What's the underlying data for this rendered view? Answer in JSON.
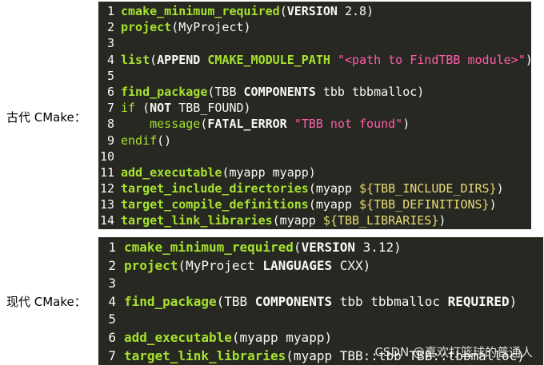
{
  "labels": {
    "old": "古代 CMake：",
    "modern": "现代 CMake："
  },
  "old_block": {
    "lines": [
      {
        "n": "1",
        "parts": [
          {
            "c": "t-k",
            "t": "cmake_minimum_required"
          },
          {
            "c": "t-p",
            "t": "("
          },
          {
            "c": "t-a",
            "t": "VERSION"
          },
          {
            "c": "t-n",
            "t": " 2.8)"
          }
        ]
      },
      {
        "n": "2",
        "parts": [
          {
            "c": "t-k",
            "t": "project"
          },
          {
            "c": "t-n",
            "t": "(MyProject)"
          }
        ]
      },
      {
        "n": "3",
        "parts": []
      },
      {
        "n": "4",
        "parts": [
          {
            "c": "t-k",
            "t": "list"
          },
          {
            "c": "t-p",
            "t": "("
          },
          {
            "c": "t-a",
            "t": "APPEND"
          },
          {
            "c": "t-n",
            "t": " "
          },
          {
            "c": "t-k",
            "t": "CMAKE_MODULE_PATH"
          },
          {
            "c": "t-n",
            "t": " "
          },
          {
            "c": "t-q",
            "t": "\"<path to FindTBB module>\""
          },
          {
            "c": "t-n",
            "t": ")"
          }
        ]
      },
      {
        "n": "5",
        "parts": []
      },
      {
        "n": "6",
        "parts": [
          {
            "c": "t-k",
            "t": "find_package"
          },
          {
            "c": "t-n",
            "t": "(TBB "
          },
          {
            "c": "t-a",
            "t": "COMPONENTS"
          },
          {
            "c": "t-n",
            "t": " tbb tbbmalloc)"
          }
        ]
      },
      {
        "n": "7",
        "parts": [
          {
            "c": "t-f",
            "t": "if"
          },
          {
            "c": "t-n",
            "t": " ("
          },
          {
            "c": "t-a",
            "t": "NOT"
          },
          {
            "c": "t-n",
            "t": " TBB_FOUND)"
          }
        ]
      },
      {
        "n": "8",
        "parts": [
          {
            "c": "t-n",
            "t": "    "
          },
          {
            "c": "t-f",
            "t": "message"
          },
          {
            "c": "t-n",
            "t": "("
          },
          {
            "c": "t-a",
            "t": "FATAL_ERROR"
          },
          {
            "c": "t-n",
            "t": " "
          },
          {
            "c": "t-q",
            "t": "\"TBB not found\""
          },
          {
            "c": "t-n",
            "t": ")"
          }
        ]
      },
      {
        "n": "9",
        "parts": [
          {
            "c": "t-f",
            "t": "endif"
          },
          {
            "c": "t-n",
            "t": "()"
          }
        ]
      },
      {
        "n": "10",
        "parts": []
      },
      {
        "n": "11",
        "parts": [
          {
            "c": "t-k",
            "t": "add_executable"
          },
          {
            "c": "t-n",
            "t": "(myapp myapp)"
          }
        ]
      },
      {
        "n": "12",
        "parts": [
          {
            "c": "t-k",
            "t": "target_include_directories"
          },
          {
            "c": "t-n",
            "t": "(myapp "
          },
          {
            "c": "t-s",
            "t": "${TBB_INCLUDE_DIRS}"
          },
          {
            "c": "t-n",
            "t": ")"
          }
        ]
      },
      {
        "n": "13",
        "parts": [
          {
            "c": "t-k",
            "t": "target_compile_definitions"
          },
          {
            "c": "t-n",
            "t": "(myapp "
          },
          {
            "c": "t-s",
            "t": "${TBB_DEFINITIONS}"
          },
          {
            "c": "t-n",
            "t": ")"
          }
        ]
      },
      {
        "n": "14",
        "parts": [
          {
            "c": "t-k",
            "t": "target_link_libraries"
          },
          {
            "c": "t-n",
            "t": "(myapp "
          },
          {
            "c": "t-s",
            "t": "${TBB_LIBRARIES}"
          },
          {
            "c": "t-n",
            "t": ")"
          }
        ]
      }
    ]
  },
  "modern_block": {
    "lines": [
      {
        "n": "1",
        "parts": [
          {
            "c": "t-k",
            "t": "cmake_minimum_required"
          },
          {
            "c": "t-p",
            "t": "("
          },
          {
            "c": "t-a",
            "t": "VERSION"
          },
          {
            "c": "t-n",
            "t": " 3.12)"
          }
        ]
      },
      {
        "n": "2",
        "parts": [
          {
            "c": "t-k",
            "t": "project"
          },
          {
            "c": "t-n",
            "t": "(MyProject "
          },
          {
            "c": "t-a",
            "t": "LANGUAGES"
          },
          {
            "c": "t-n",
            "t": " CXX)"
          }
        ]
      },
      {
        "n": "3",
        "parts": []
      },
      {
        "n": "4",
        "parts": [
          {
            "c": "t-k",
            "t": "find_package"
          },
          {
            "c": "t-n",
            "t": "(TBB "
          },
          {
            "c": "t-a",
            "t": "COMPONENTS"
          },
          {
            "c": "t-n",
            "t": " tbb tbbmalloc "
          },
          {
            "c": "t-a",
            "t": "REQUIRED"
          },
          {
            "c": "t-n",
            "t": ")"
          }
        ]
      },
      {
        "n": "5",
        "parts": []
      },
      {
        "n": "6",
        "parts": [
          {
            "c": "t-k",
            "t": "add_executable"
          },
          {
            "c": "t-n",
            "t": "(myapp myapp)"
          }
        ]
      },
      {
        "n": "7",
        "parts": [
          {
            "c": "t-k",
            "t": "target_link_libraries"
          },
          {
            "c": "t-n",
            "t": "(myapp TBB::tbb TBB::tbbmalloc)"
          }
        ]
      }
    ]
  },
  "watermark": "CSDN @喜欢打篮球的普通人"
}
